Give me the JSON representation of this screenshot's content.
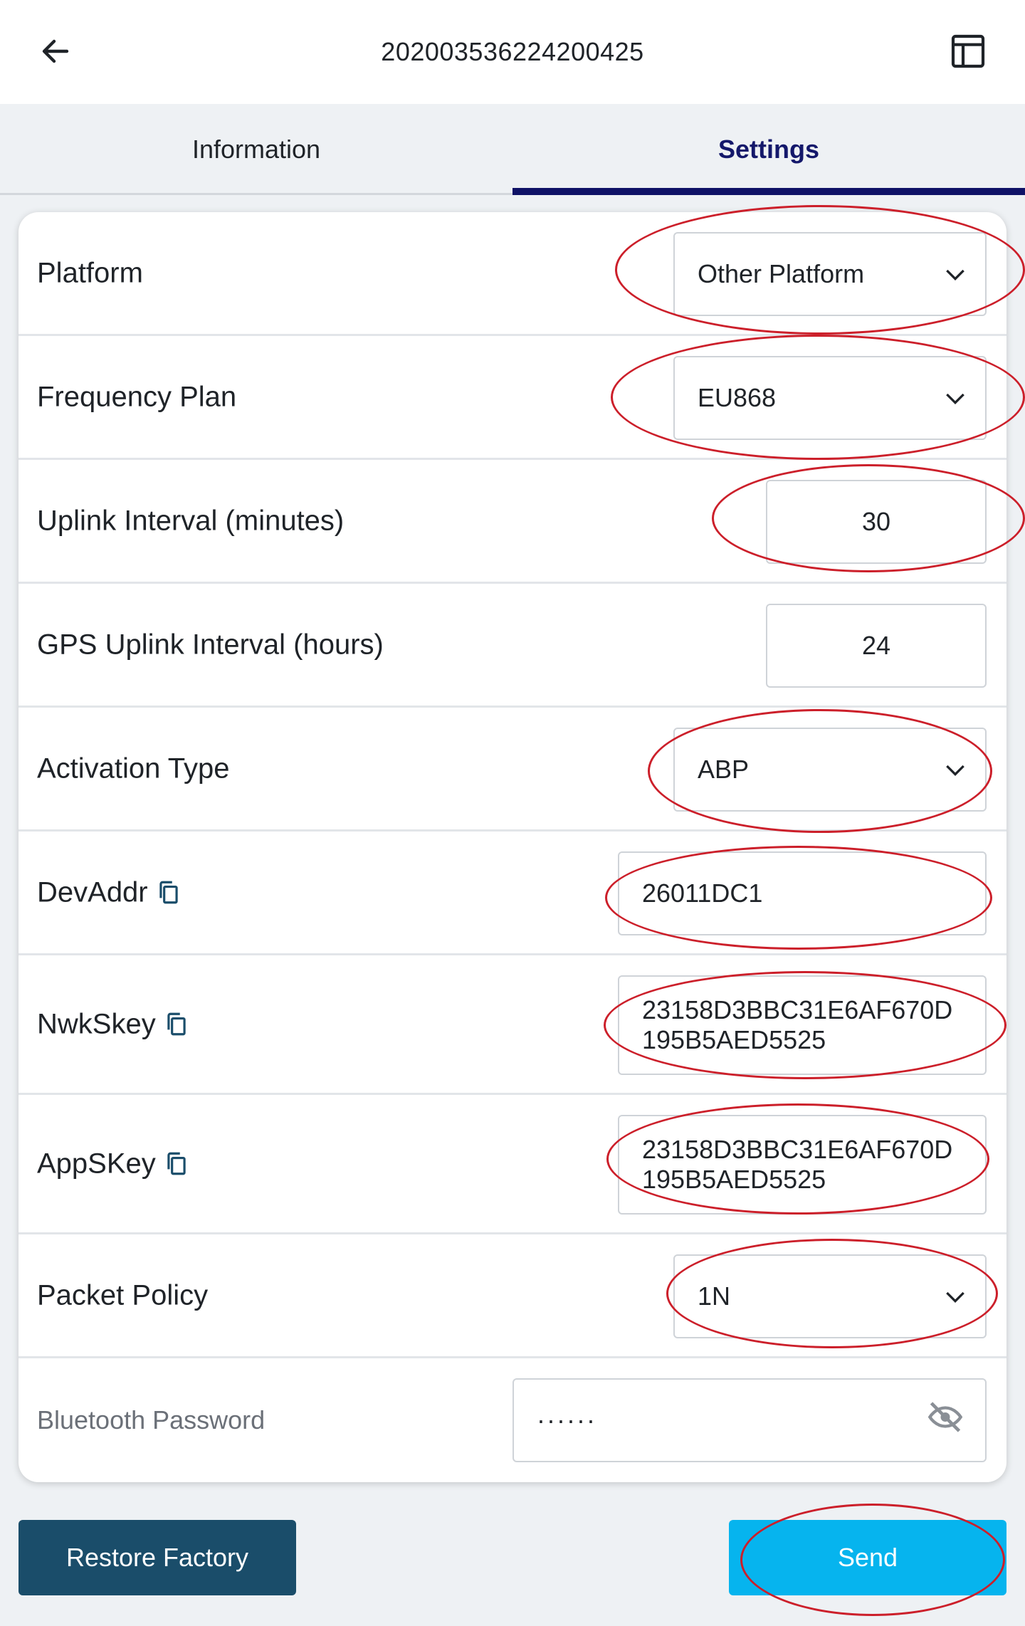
{
  "header": {
    "title": "202003536224200425",
    "back_icon": "arrow-left-icon",
    "layout_icon": "layout-panel-icon"
  },
  "tabs": [
    {
      "label": "Information",
      "active": false
    },
    {
      "label": "Settings",
      "active": true
    }
  ],
  "settings": {
    "platform": {
      "label": "Platform",
      "value": "Other Platform"
    },
    "frequency_plan": {
      "label": "Frequency Plan",
      "value": "EU868"
    },
    "uplink_interval": {
      "label": "Uplink Interval (minutes)",
      "value": "30"
    },
    "gps_uplink_interval": {
      "label": "GPS Uplink Interval (hours)",
      "value": "24"
    },
    "activation_type": {
      "label": "Activation Type",
      "value": "ABP"
    },
    "devaddr": {
      "label": "DevAddr",
      "value": "26011DC1"
    },
    "nwkskey": {
      "label": "NwkSkey",
      "value": "23158D3BBC31E6AF670D\n195B5AED5525"
    },
    "appskey": {
      "label": "AppSKey",
      "value": "23158D3BBC31E6AF670D\n195B5AED5525"
    },
    "packet_policy": {
      "label": "Packet Policy",
      "value": "1N"
    },
    "bluetooth_password": {
      "label": "Bluetooth Password",
      "value": "······"
    }
  },
  "actions": {
    "restore_label": "Restore Factory",
    "send_label": "Send"
  },
  "colors": {
    "accent_dark": "#0f1266",
    "restore_bg": "#1a4d6a",
    "send_bg": "#06b4ee",
    "annotation_ring": "#cc1f2a"
  }
}
